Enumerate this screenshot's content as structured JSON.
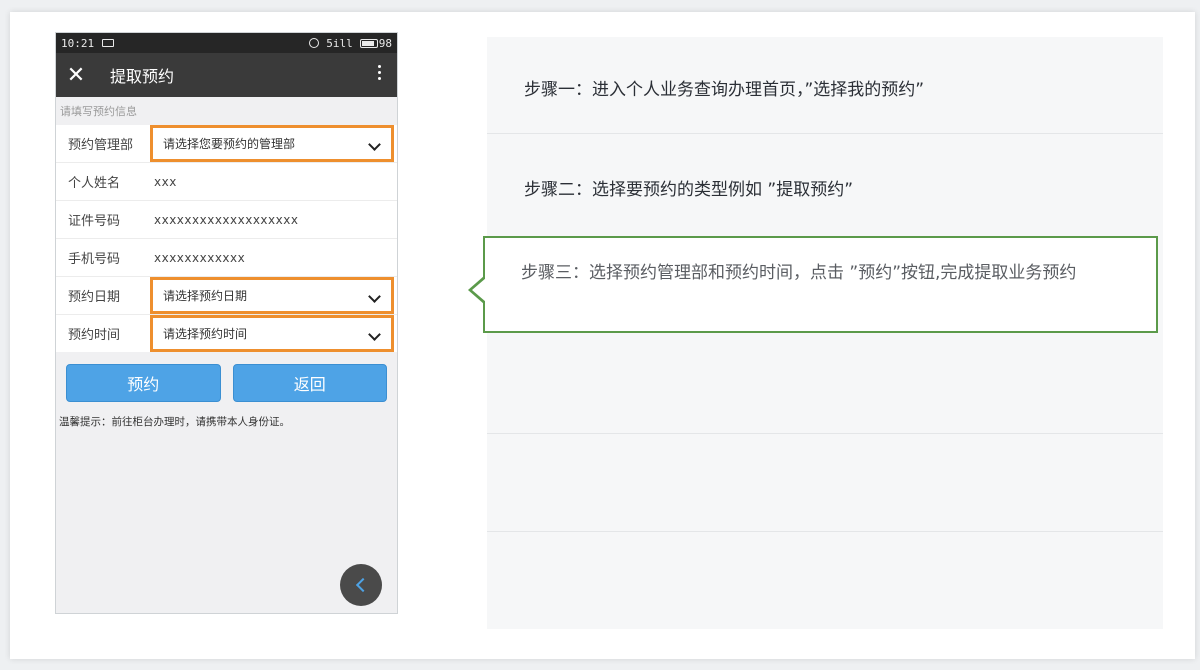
{
  "phone": {
    "status": {
      "time": "10:21",
      "signal": "5ill",
      "battery": "98"
    },
    "title": "提取预约",
    "close_glyph": "✕",
    "form_hint": "请填写预约信息",
    "fields": [
      {
        "label": "预约管理部",
        "value": "请选择您要预约的管理部",
        "type": "select"
      },
      {
        "label": "个人姓名",
        "value": "xxx",
        "type": "text"
      },
      {
        "label": "证件号码",
        "value": "xxxxxxxxxxxxxxxxxxx",
        "type": "text"
      },
      {
        "label": "手机号码",
        "value": "xxxxxxxxxxxx",
        "type": "text"
      },
      {
        "label": "预约日期",
        "value": "请选择预约日期",
        "type": "select"
      },
      {
        "label": "预约时间",
        "value": "请选择预约时间",
        "type": "select"
      }
    ],
    "buttons": {
      "reserve": "预约",
      "back": "返回"
    },
    "tip": "温馨提示：前往柜台办理时，请携带本人身份证。",
    "colors": {
      "highlight": "#ee8f2e",
      "button": "#4ea3e6"
    }
  },
  "steps": [
    "步骤一：进入个人业务查询办理首页，”选择我的预约”",
    "步骤二：选择要预约的类型例如 ”提取预约”",
    "步骤三：选择预约管理部和预约时间，点击 ”预约”按钮,完成提取业务预约"
  ],
  "colors": {
    "active_step_border": "#5b9a4a"
  }
}
